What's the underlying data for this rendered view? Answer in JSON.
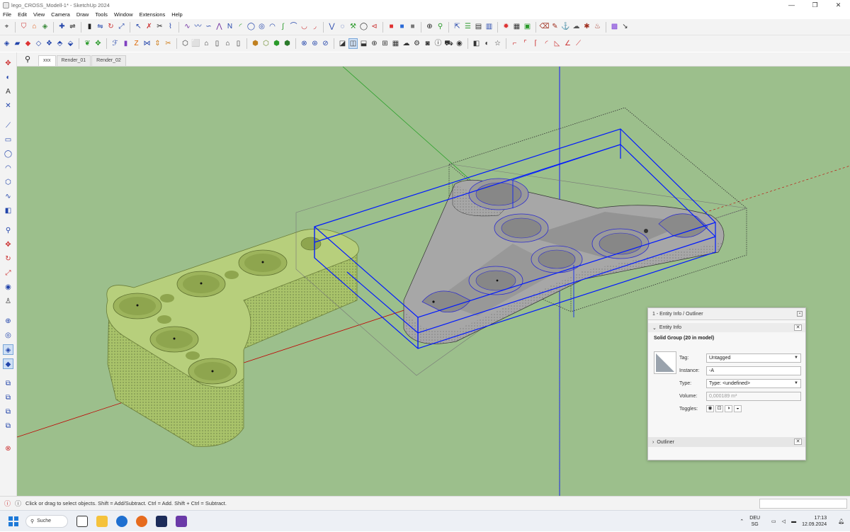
{
  "window": {
    "title": "lego_CROSS_Modell-1* - SketchUp 2024"
  },
  "menu": [
    "File",
    "Edit",
    "View",
    "Camera",
    "Draw",
    "Tools",
    "Window",
    "Extensions",
    "Help"
  ],
  "scene_tabs": [
    "xxx",
    "Render_01",
    "Render_02"
  ],
  "active_scene": "xxx",
  "viewport": {
    "background": "#9cbf8c",
    "selection_color": "#0019ff"
  },
  "entity_panel": {
    "title": "1 - Entity Info / Outliner",
    "section": "Entity Info",
    "entity_name": "Solid Group (20 in model)",
    "fields": {
      "tag_label": "Tag:",
      "tag_value": "Untagged",
      "instance_label": "Instance:",
      "instance_value": "-A",
      "type_label": "Type:",
      "type_value": "Type: <undefined>",
      "volume_label": "Volume:",
      "volume_value": "0,000189 m³",
      "toggles_label": "Toggles:"
    },
    "outliner_label": "Outliner"
  },
  "status": {
    "text": "Click or drag to select objects. Shift = Add/Subtract. Ctrl = Add. Shift + Ctrl = Subtract."
  },
  "taskbar": {
    "search": "Suche",
    "lang_line1": "DEU",
    "lang_line2": "SG",
    "time": "17:13",
    "date": "12.09.2024"
  }
}
